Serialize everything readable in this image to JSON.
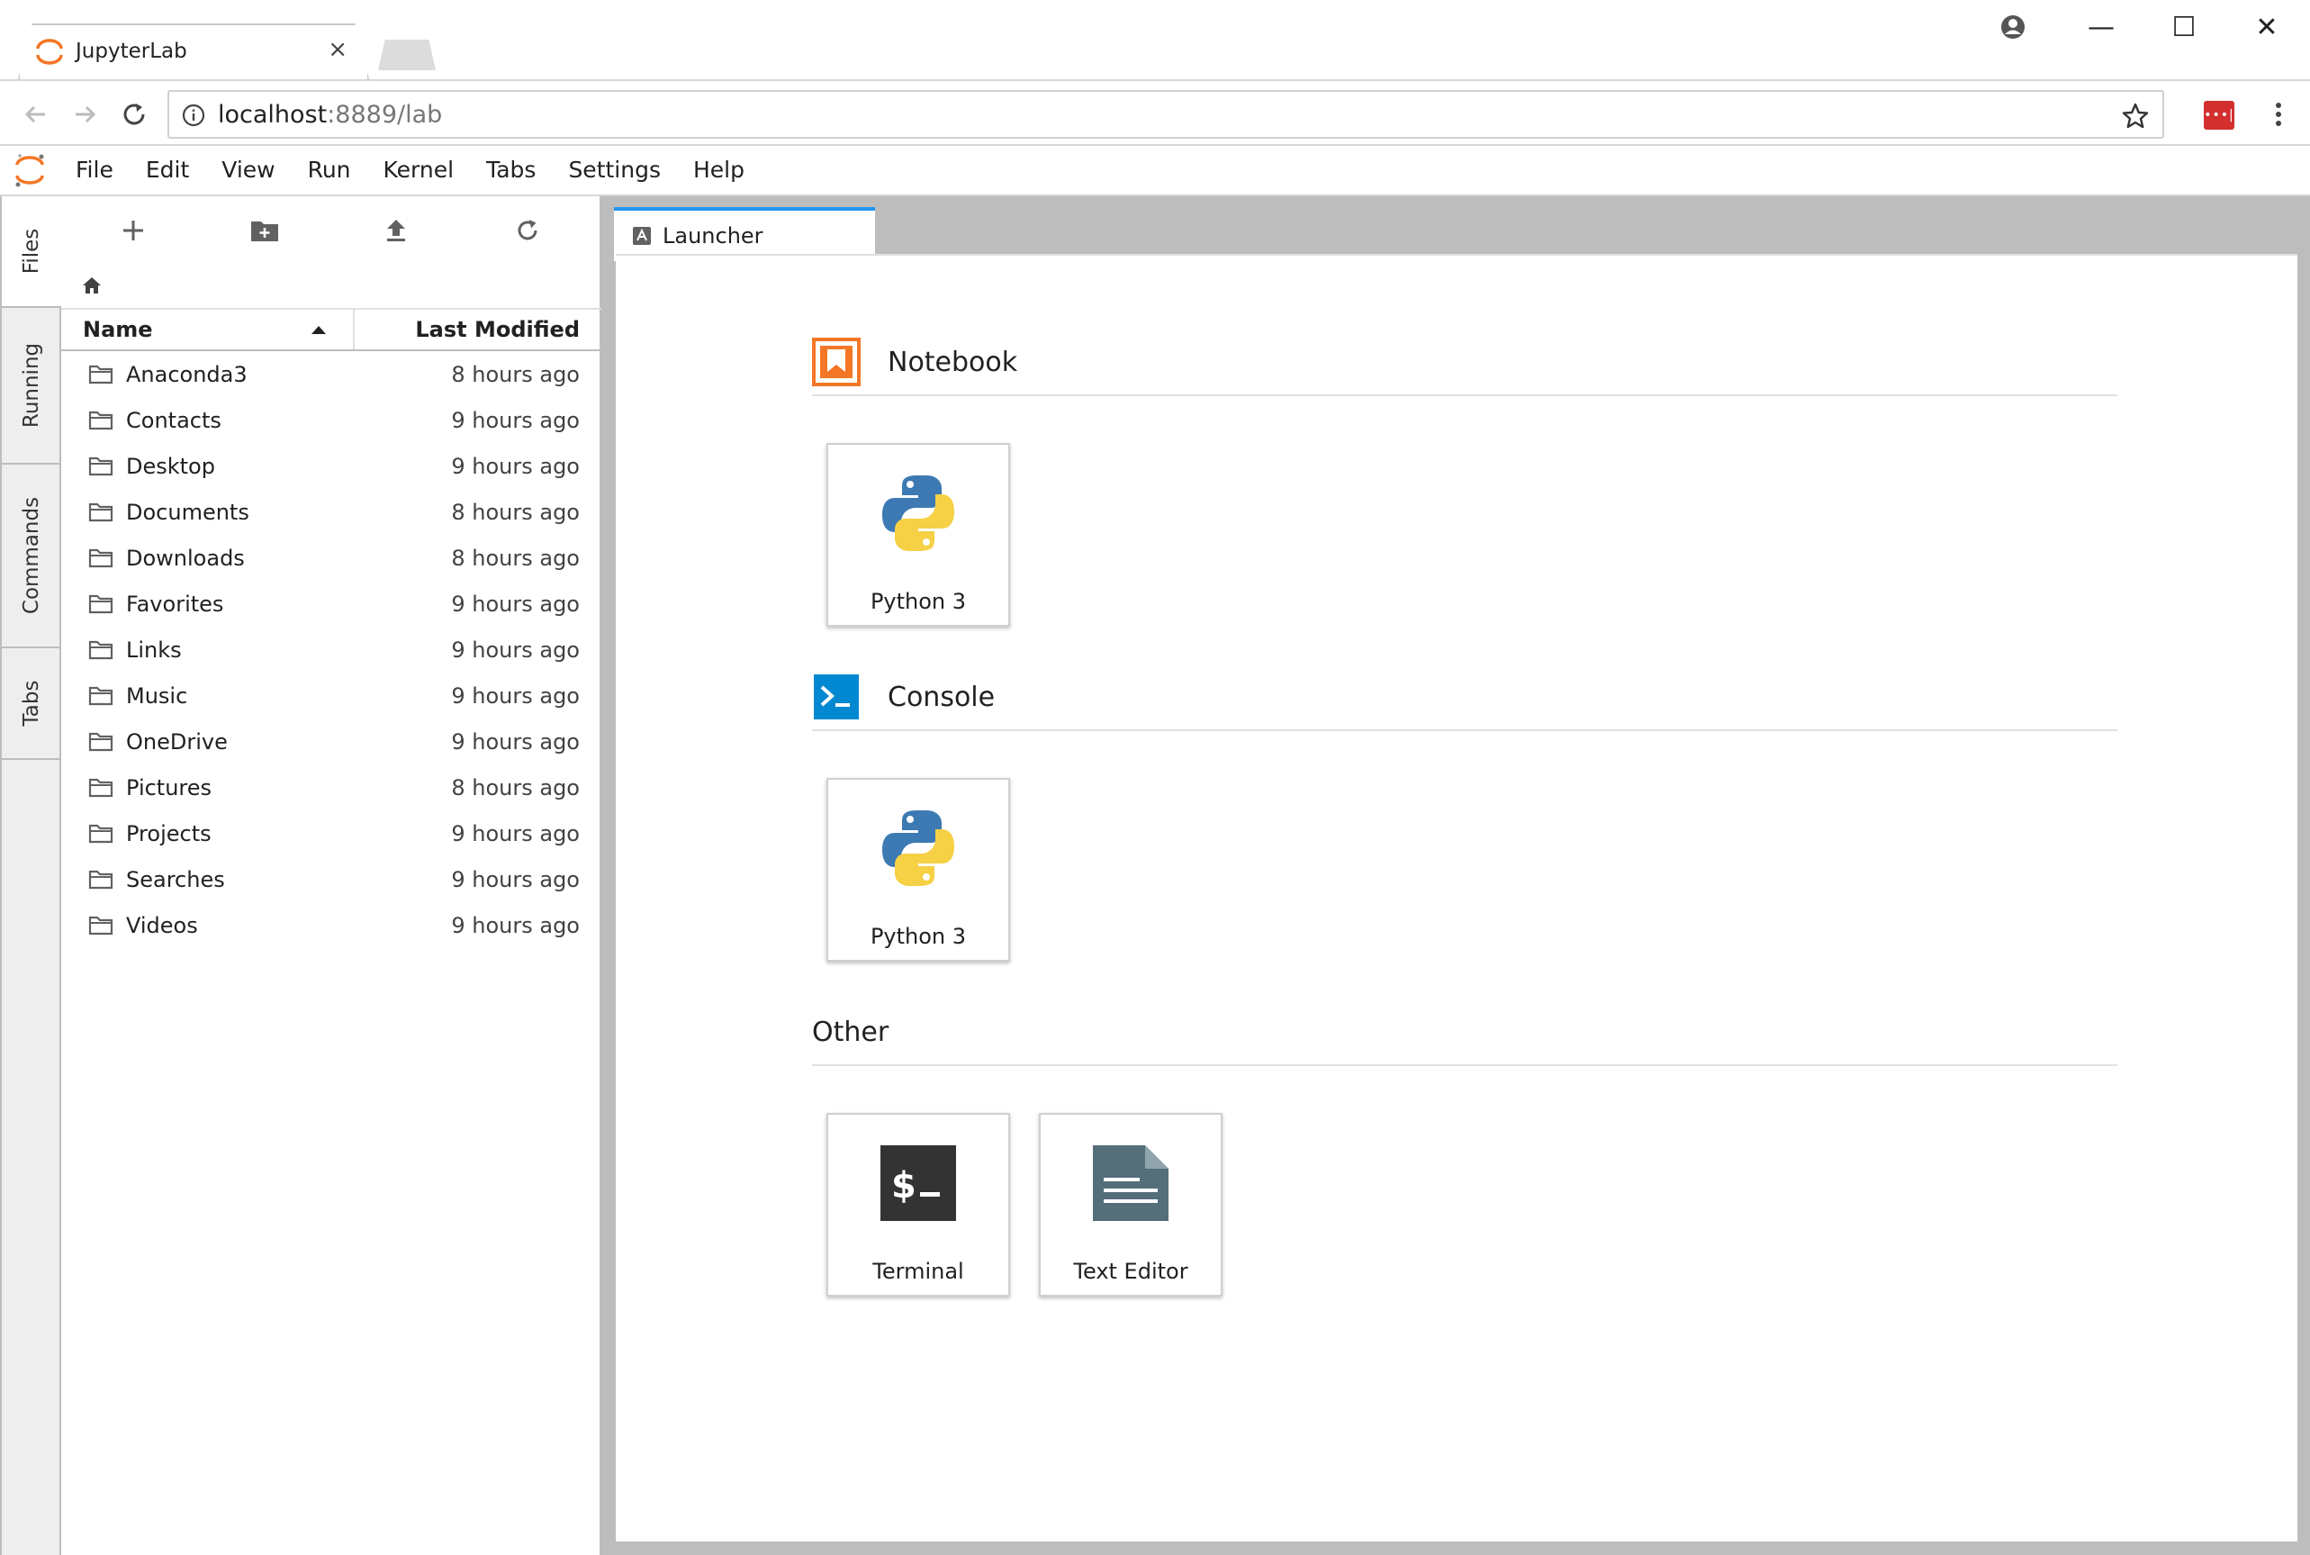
{
  "browser": {
    "tab_title": "JupyterLab",
    "tab_close": "×",
    "url_host": "localhost",
    "url_rest": ":8889/lab",
    "ext_label": "•••|",
    "controls": {
      "minimize": "—",
      "maximize": "☐",
      "close": "✕"
    }
  },
  "menu": {
    "items": [
      "File",
      "Edit",
      "View",
      "Run",
      "Kernel",
      "Tabs",
      "Settings",
      "Help"
    ]
  },
  "sidebar": {
    "tabs": [
      "Files",
      "Running",
      "Commands",
      "Tabs"
    ]
  },
  "filebrowser": {
    "columns": {
      "name": "Name",
      "modified": "Last Modified"
    },
    "sort": "ascending",
    "files": [
      {
        "name": "Anaconda3",
        "modified": "8 hours ago"
      },
      {
        "name": "Contacts",
        "modified": "9 hours ago"
      },
      {
        "name": "Desktop",
        "modified": "9 hours ago"
      },
      {
        "name": "Documents",
        "modified": "8 hours ago"
      },
      {
        "name": "Downloads",
        "modified": "8 hours ago"
      },
      {
        "name": "Favorites",
        "modified": "9 hours ago"
      },
      {
        "name": "Links",
        "modified": "9 hours ago"
      },
      {
        "name": "Music",
        "modified": "9 hours ago"
      },
      {
        "name": "OneDrive",
        "modified": "9 hours ago"
      },
      {
        "name": "Pictures",
        "modified": "8 hours ago"
      },
      {
        "name": "Projects",
        "modified": "9 hours ago"
      },
      {
        "name": "Searches",
        "modified": "9 hours ago"
      },
      {
        "name": "Videos",
        "modified": "9 hours ago"
      }
    ]
  },
  "main": {
    "tab_label": "Launcher"
  },
  "launcher": {
    "notebook": {
      "title": "Notebook",
      "cards": [
        {
          "label": "Python 3",
          "icon": "python-icon"
        }
      ]
    },
    "console": {
      "title": "Console",
      "cards": [
        {
          "label": "Python 3",
          "icon": "python-icon"
        }
      ]
    },
    "other": {
      "title": "Other",
      "cards": [
        {
          "label": "Terminal",
          "icon": "terminal-icon"
        },
        {
          "label": "Text Editor",
          "icon": "text-editor-icon"
        }
      ]
    }
  },
  "colors": {
    "accent": "#2196f3",
    "jupyter_orange": "#f37726",
    "console_blue": "#0288d1",
    "sidebar_bg": "#eeeeee",
    "main_bg": "#bdbdbd"
  }
}
